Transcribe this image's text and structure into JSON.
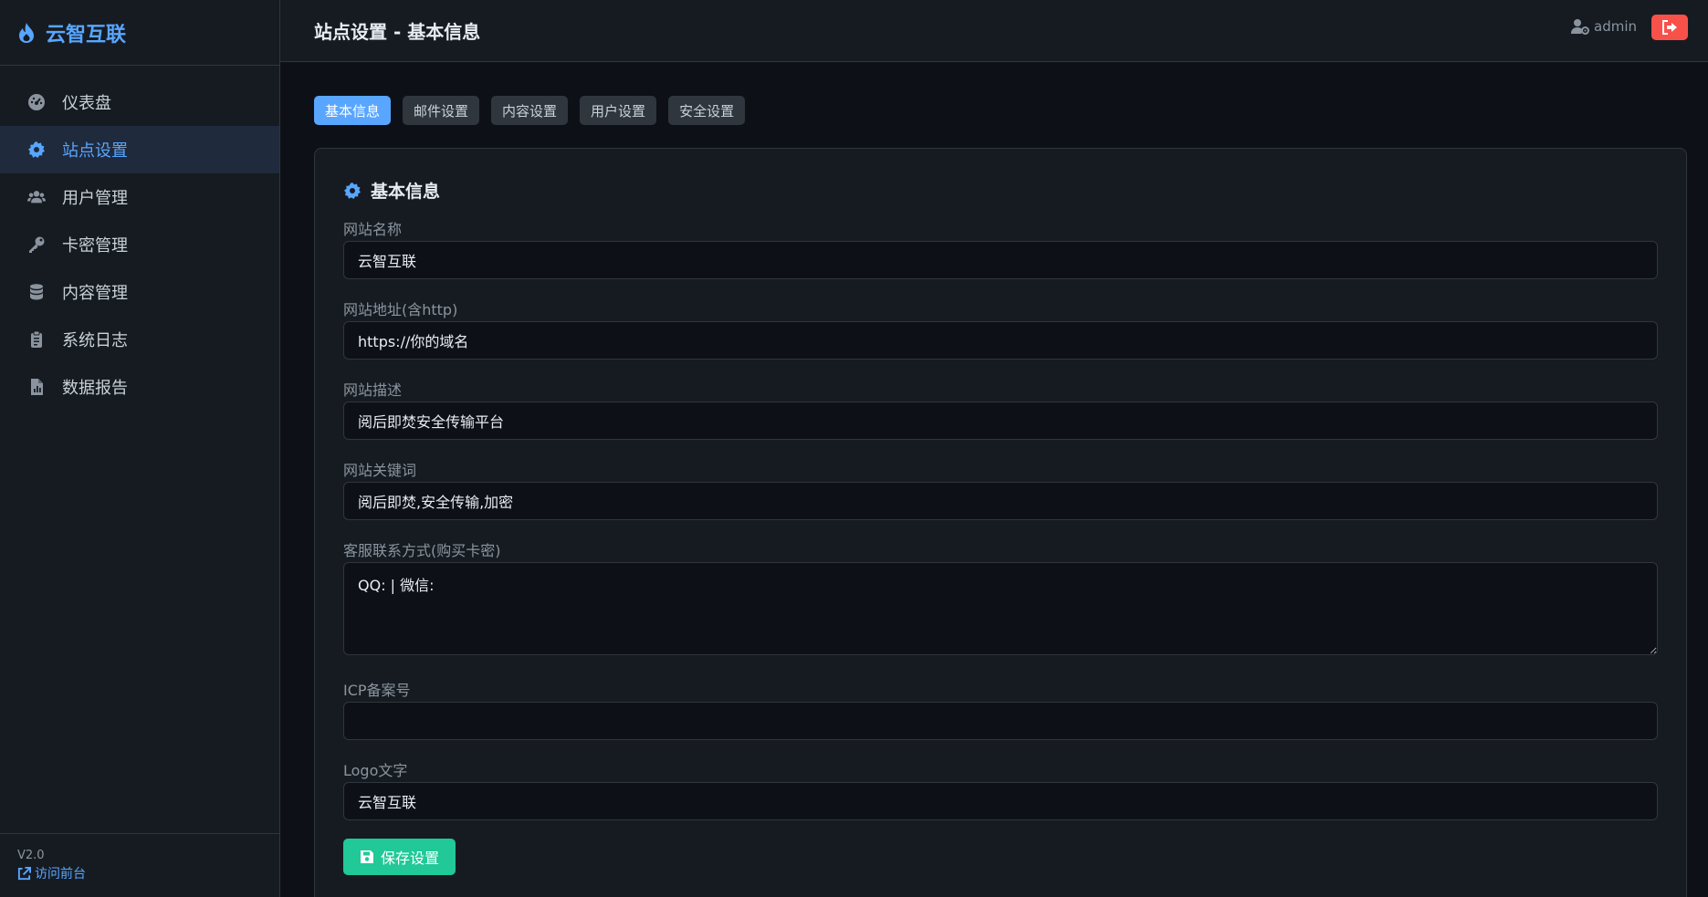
{
  "brand": {
    "name": "云智互联",
    "icon": "flame-icon"
  },
  "sidebar": {
    "items": [
      {
        "label": "仪表盘",
        "icon": "dashboard-icon",
        "active": false
      },
      {
        "label": "站点设置",
        "icon": "gear-icon",
        "active": true
      },
      {
        "label": "用户管理",
        "icon": "users-icon",
        "active": false
      },
      {
        "label": "卡密管理",
        "icon": "key-icon",
        "active": false
      },
      {
        "label": "内容管理",
        "icon": "database-icon",
        "active": false
      },
      {
        "label": "系统日志",
        "icon": "clipboard-icon",
        "active": false
      },
      {
        "label": "数据报告",
        "icon": "file-chart-icon",
        "active": false
      }
    ],
    "version": "V2.0",
    "visit_label": "访问前台"
  },
  "header": {
    "title": "站点设置 - 基本信息",
    "username": "admin"
  },
  "tabs": [
    {
      "label": "基本信息",
      "active": true
    },
    {
      "label": "邮件设置",
      "active": false
    },
    {
      "label": "内容设置",
      "active": false
    },
    {
      "label": "用户设置",
      "active": false
    },
    {
      "label": "安全设置",
      "active": false
    }
  ],
  "form": {
    "title": "基本信息",
    "site_name": {
      "label": "网站名称",
      "value": "云智互联"
    },
    "site_url": {
      "label": "网站地址(含http)",
      "value": "https://你的域名"
    },
    "site_desc": {
      "label": "网站描述",
      "value": "阅后即焚安全传输平台"
    },
    "site_keywords": {
      "label": "网站关键词",
      "value": "阅后即焚,安全传输,加密"
    },
    "contact": {
      "label": "客服联系方式(购买卡密)",
      "value": "QQ: | 微信:"
    },
    "icp": {
      "label": "ICP备案号",
      "value": ""
    },
    "logo_text": {
      "label": "Logo文字",
      "value": "云智互联"
    },
    "save_label": "保存设置"
  },
  "colors": {
    "accent": "#58a6ff",
    "success": "#20c997",
    "danger": "#f85149",
    "background": "#0d1117",
    "panel": "#161b22"
  }
}
